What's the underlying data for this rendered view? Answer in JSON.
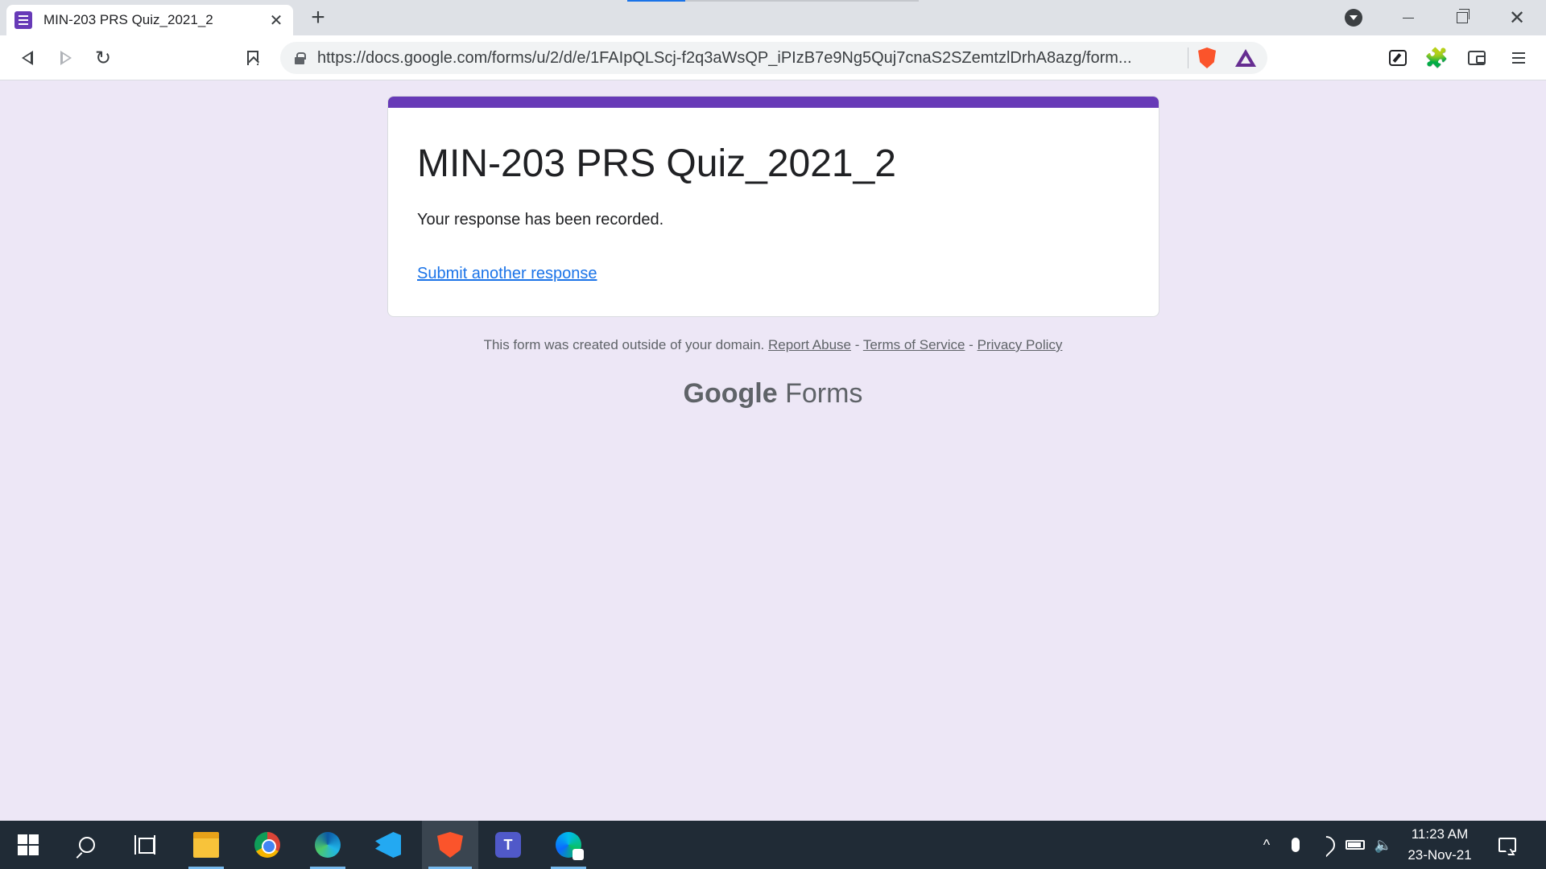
{
  "browser": {
    "tab": {
      "title": "MIN-203 PRS Quiz_2021_2",
      "close_glyph": "✕"
    },
    "new_tab_glyph": "+",
    "url": "https://docs.google.com/forms/u/2/d/e/1FAIpQLScj-f2q3aWsQP_iPIzB7e9Ng5Quj7cnaS2SZemtzlDrhA8azg/form...",
    "window_close_glyph": "✕"
  },
  "form": {
    "title": "MIN-203 PRS Quiz_2021_2",
    "confirmation": "Your response has been recorded.",
    "another_response_link": "Submit another response",
    "accent_color": "#673ab7"
  },
  "footer": {
    "note": "This form was created outside of your domain.",
    "report_abuse": "Report Abuse",
    "sep": "-",
    "terms": "Terms of Service",
    "privacy": "Privacy Policy"
  },
  "branding": {
    "google": "Google",
    "forms": "Forms"
  },
  "taskbar": {
    "apps": [
      "start-icon",
      "search-icon",
      "task-view-icon",
      "file-explorer-icon",
      "chrome-icon",
      "edge-icon",
      "vscode-icon",
      "brave-icon",
      "teams-icon",
      "webex-icon"
    ],
    "teams_letter": "T",
    "tray_chevron": "^",
    "volume_glyph": "🔈",
    "time": "11:23 AM",
    "date": "23-Nov-21"
  },
  "colors": {
    "page_bg": "#ede7f6",
    "link": "#1a73e8",
    "taskbar_bg": "#202b36"
  }
}
